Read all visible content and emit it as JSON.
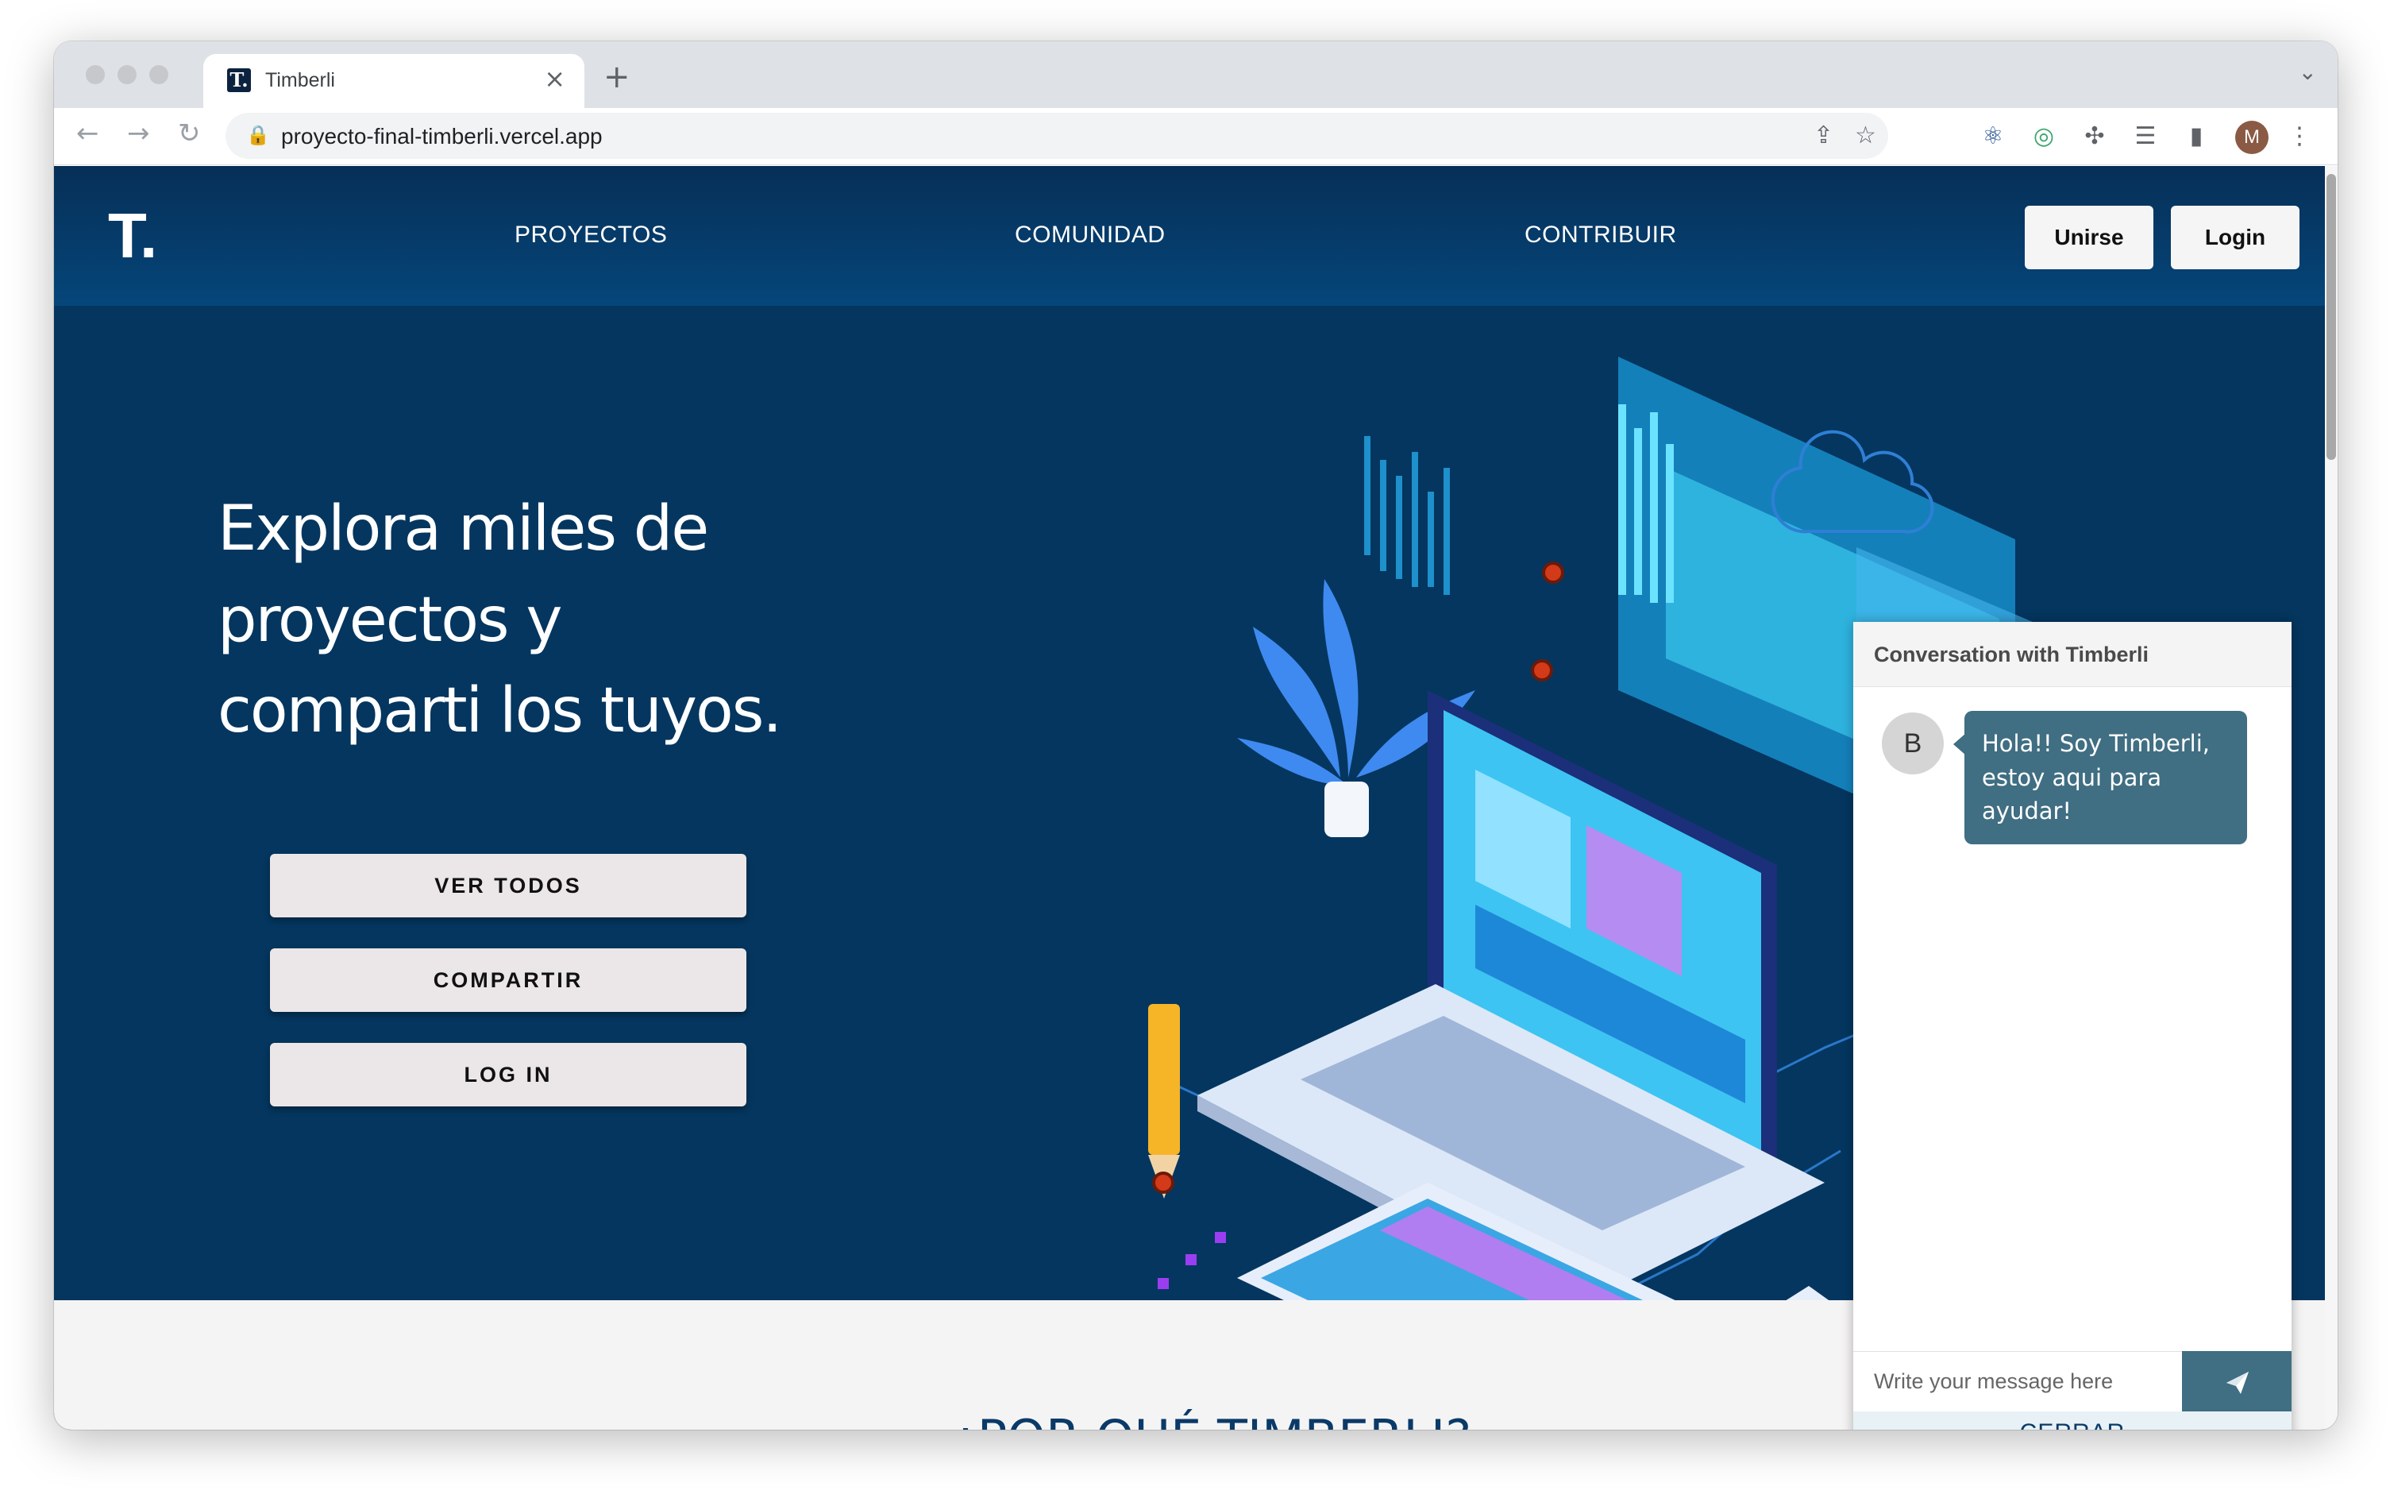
{
  "browser": {
    "tab_title": "Timberli",
    "tab_favicon": "T.",
    "tab_close": "×",
    "new_tab": "+",
    "tab_menu": "⌄",
    "url": "proyecto-final-timberli.vercel.app",
    "profile_initial": "M"
  },
  "nav": {
    "logo": "T.",
    "links": [
      "PROYECTOS",
      "COMUNIDAD",
      "CONTRIBUIR"
    ],
    "join_label": "Unirse",
    "login_label": "Login"
  },
  "hero": {
    "title_lines": [
      "Explora miles de",
      "proyectos y",
      "comparti los tuyos."
    ],
    "buttons": [
      "VER TODOS",
      "COMPARTIR",
      "LOG IN"
    ]
  },
  "section": {
    "heading": "¿POR QUÉ TIMBERLI?"
  },
  "chat": {
    "title": "Conversation with Timberli",
    "bot_avatar": "B",
    "message": "Hola!! Soy Timberli, estoy aqui para ayudar!",
    "input_placeholder": "Write your message here",
    "close_label": "CERRAR"
  },
  "colors": {
    "page_bg": "#04365f",
    "chat_accent": "#406e82",
    "button_bg": "#ebe7e8"
  }
}
